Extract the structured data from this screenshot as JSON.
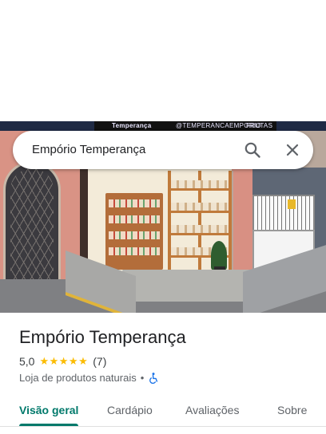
{
  "search": {
    "query": "Empório Temperança"
  },
  "photo": {
    "sign_left": "Temperança",
    "sign_mid": "@TEMPERANCAEMPORIO",
    "sign_right": "FRUTAS"
  },
  "place": {
    "name": "Empório Temperança",
    "rating": "5,0",
    "stars": "★★★★★",
    "reviews": "(7)",
    "category": "Loja de produtos naturais",
    "separator": "•",
    "accessibility_icon": "wheelchair-icon"
  },
  "tabs": [
    {
      "label": "Visão geral",
      "active": true
    },
    {
      "label": "Cardápio",
      "active": false
    },
    {
      "label": "Avaliações",
      "active": false
    },
    {
      "label": "Sobre",
      "active": false
    }
  ],
  "colors": {
    "accent": "#00796b",
    "star": "#fbbc04"
  }
}
